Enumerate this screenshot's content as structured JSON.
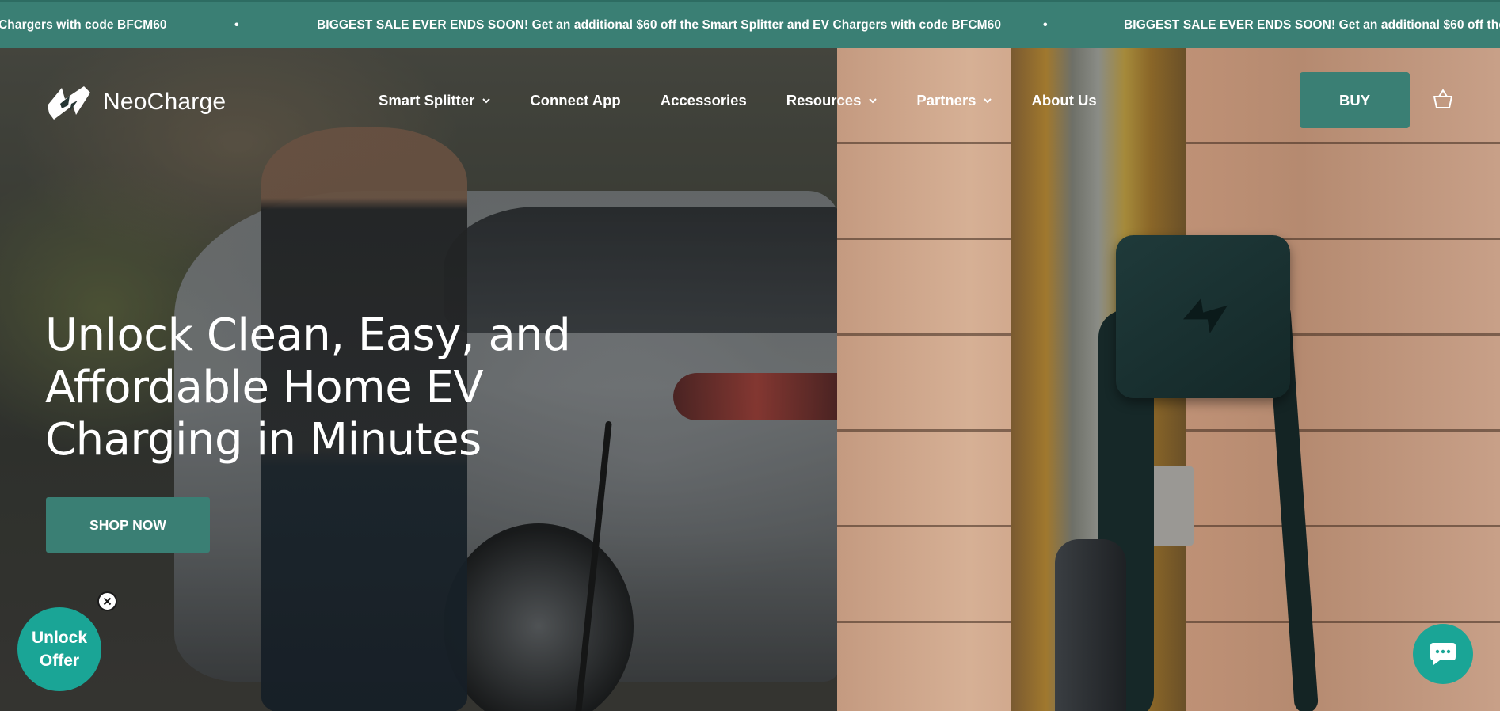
{
  "announcement": {
    "message": "BIGGEST SALE EVER ENDS SOON! Get an additional $60 off the Smart Splitter and EV Chargers with code BFCM60",
    "fragment_left": "Chargers with code BFCM60",
    "fragment_right": "BIGGEST SALE EVER ENDS SOON! Get an additional $60 off the Sm",
    "separator": "•"
  },
  "brand": {
    "name": "NeoCharge",
    "logo_icon": "lightning-bolt-logo-icon",
    "accent_color": "#3a7f74",
    "teal_color": "#1aa596"
  },
  "nav": {
    "items": [
      {
        "label": "Smart Splitter",
        "has_dropdown": true
      },
      {
        "label": "Connect App",
        "has_dropdown": false
      },
      {
        "label": "Accessories",
        "has_dropdown": false
      },
      {
        "label": "Resources",
        "has_dropdown": true
      },
      {
        "label": "Partners",
        "has_dropdown": true
      },
      {
        "label": "About Us",
        "has_dropdown": false
      }
    ],
    "buy_label": "BUY",
    "cart_icon": "basket-icon"
  },
  "hero": {
    "headline_lines": [
      "Unlock Clean, Easy, and",
      "Affordable Home EV",
      "Charging in Minutes"
    ],
    "cta_label": "SHOP NOW"
  },
  "offer_widget": {
    "line1": "Unlock",
    "line2": "Offer",
    "close_icon": "close-icon"
  },
  "chat_widget": {
    "icon": "chat-bubble-icon"
  }
}
